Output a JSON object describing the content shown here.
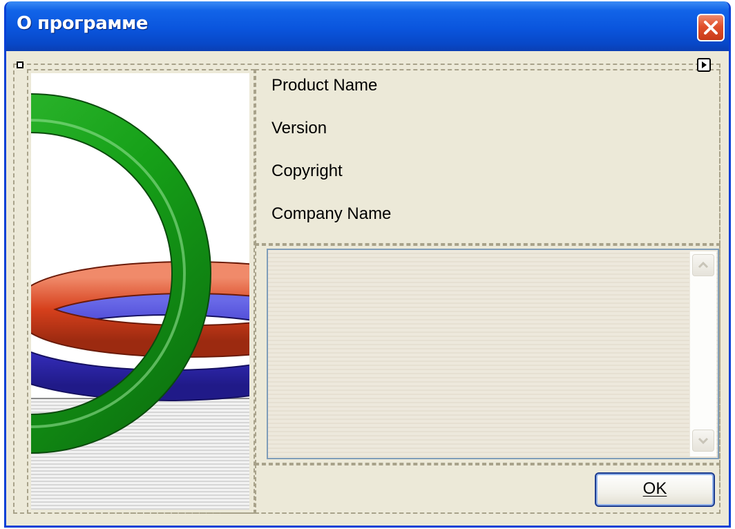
{
  "window": {
    "title": "О программе"
  },
  "fields": {
    "product_name": "Product Name",
    "version": "Version",
    "copyright": "Copyright",
    "company_name": "Company Name"
  },
  "description": {
    "value": ""
  },
  "buttons": {
    "ok_label": "OK"
  },
  "colors": {
    "titlebar": "#0a55dd",
    "dialog_bg": "#ece9d8",
    "close_button": "#e0502c"
  },
  "icons": {
    "close": "close-icon",
    "scroll_up": "chevron-up-icon",
    "scroll_down": "chevron-down-icon"
  }
}
